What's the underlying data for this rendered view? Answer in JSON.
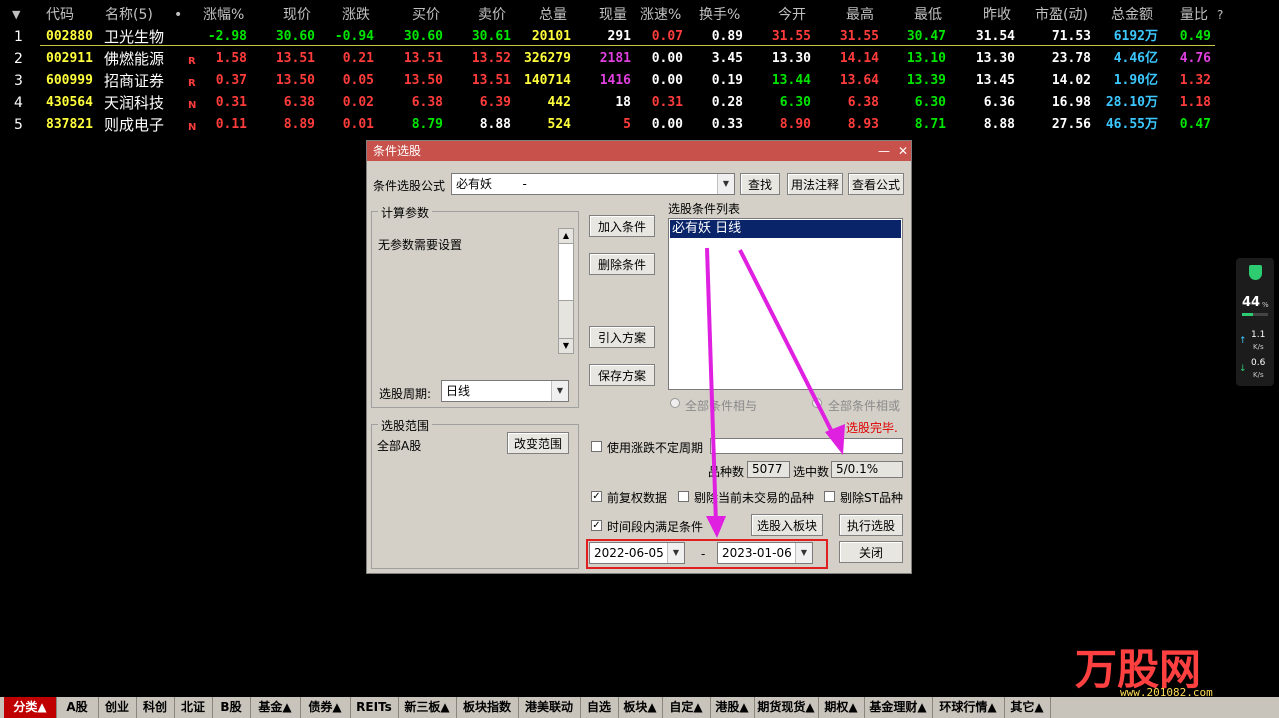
{
  "table": {
    "sort_indicator": "▼",
    "headers": [
      "代码",
      "名称(5)",
      "•",
      "涨幅%",
      "现价",
      "涨跌",
      "买价",
      "卖价",
      "总量",
      "现量",
      "涨速%",
      "换手%",
      "今开",
      "最高",
      "最低",
      "昨收",
      "市盈(动)",
      "总金额",
      "量比",
      "?"
    ],
    "rows": [
      {
        "idx": "1",
        "code": "002880",
        "name": "卫光生物",
        "flag": "",
        "chg_pct": "-2.98",
        "price": "30.60",
        "chg": "-0.94",
        "bid": "30.60",
        "ask": "30.61",
        "vol": "20101",
        "cur_vol": "291",
        "speed": "0.07",
        "turnover": "0.89",
        "open": "31.55",
        "high": "31.55",
        "low": "30.47",
        "prev": "31.54",
        "pe": "71.53",
        "amount": "6192万",
        "vol_ratio": "0.49"
      },
      {
        "idx": "2",
        "code": "002911",
        "name": "佛燃能源",
        "flag": "R",
        "chg_pct": "1.58",
        "price": "13.51",
        "chg": "0.21",
        "bid": "13.51",
        "ask": "13.52",
        "vol": "326279",
        "cur_vol": "2181",
        "speed": "0.00",
        "turnover": "3.45",
        "open": "13.30",
        "high": "14.14",
        "low": "13.10",
        "prev": "13.30",
        "pe": "23.78",
        "amount": "4.46亿",
        "vol_ratio": "4.76"
      },
      {
        "idx": "3",
        "code": "600999",
        "name": "招商证券",
        "flag": "R",
        "chg_pct": "0.37",
        "price": "13.50",
        "chg": "0.05",
        "bid": "13.50",
        "ask": "13.51",
        "vol": "140714",
        "cur_vol": "1416",
        "speed": "0.00",
        "turnover": "0.19",
        "open": "13.44",
        "high": "13.64",
        "low": "13.39",
        "prev": "13.45",
        "pe": "14.02",
        "amount": "1.90亿",
        "vol_ratio": "1.32"
      },
      {
        "idx": "4",
        "code": "430564",
        "name": "天润科技",
        "flag": "N",
        "chg_pct": "0.31",
        "price": "6.38",
        "chg": "0.02",
        "bid": "6.38",
        "ask": "6.39",
        "vol": "442",
        "cur_vol": "18",
        "speed": "0.31",
        "turnover": "0.28",
        "open": "6.30",
        "high": "6.38",
        "low": "6.30",
        "prev": "6.36",
        "pe": "16.98",
        "amount": "28.10万",
        "vol_ratio": "1.18"
      },
      {
        "idx": "5",
        "code": "837821",
        "name": "则成电子",
        "flag": "N",
        "chg_pct": "0.11",
        "price": "8.89",
        "chg": "0.01",
        "bid": "8.79",
        "ask": "8.88",
        "vol": "524",
        "cur_vol": "5",
        "speed": "0.00",
        "turnover": "0.33",
        "open": "8.90",
        "high": "8.93",
        "low": "8.71",
        "prev": "8.88",
        "pe": "27.56",
        "amount": "46.55万",
        "vol_ratio": "0.47"
      }
    ]
  },
  "dialog": {
    "title": "条件选股",
    "minimize": "—",
    "close": "✕",
    "formula_label": "条件选股公式",
    "formula_value": "必有妖        -",
    "btn_find": "查找",
    "btn_usage": "用法注释",
    "btn_view": "查看公式",
    "params_group": "计算参数",
    "params_text": "无参数需要设置",
    "period_label": "选股周期:",
    "period_value": "日线",
    "range_group": "选股范围",
    "range_value": "全部A股",
    "btn_change_range": "改变范围",
    "btn_add": "加入条件",
    "btn_delete": "删除条件",
    "btn_import": "引入方案",
    "btn_save": "保存方案",
    "cond_list_label": "选股条件列表",
    "cond_items": [
      "必有妖  日线"
    ],
    "radio_and": "全部条件相与",
    "radio_or": "全部条件相或",
    "status": "选股完毕.",
    "use_period_label": "使用涨跌不定周期",
    "count_label": "品种数",
    "count_value": "5077",
    "selected_label": "选中数",
    "selected_value": "5/0.1%",
    "adj_label": "前复权数据",
    "exclude_suspended": "剔除当前未交易的品种",
    "exclude_st": "剔除ST品种",
    "time_range_label": "时间段内满足条件",
    "btn_to_block": "选股入板块",
    "btn_execute": "执行选股",
    "date_start": "2022-06-05",
    "date_sep": "-",
    "date_end": "2023-01-06",
    "btn_close": "关闭"
  },
  "side_widget": {
    "percent": "44",
    "percent_unit": "%",
    "up_speed": "1.1",
    "up_unit": "K/s",
    "down_speed": "0.6",
    "down_unit": "K/s"
  },
  "tabs": [
    "分类▲",
    "A股",
    "创业",
    "科创",
    "北证",
    "B股",
    "基金▲",
    "债券▲",
    "REITs",
    "新三板▲",
    "板块指数",
    "港美联动",
    "自选",
    "板块▲",
    "自定▲",
    "港股▲",
    "期货现货▲",
    "期权▲",
    "基金理财▲",
    "环球行情▲",
    "其它▲"
  ],
  "watermark": {
    "logo": "万股网",
    "url": "www.201082.com"
  }
}
